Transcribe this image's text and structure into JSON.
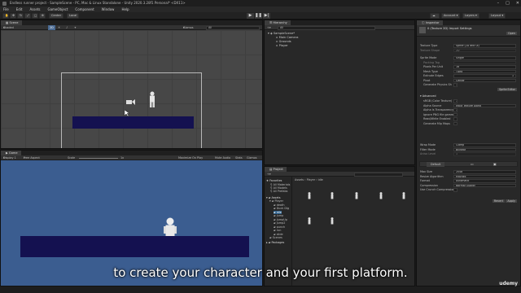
{
  "window": {
    "title": "Endless runner project - SampleScene - PC, Mac & Linux Standalone - Unity 2020.3.28f1 Personal* <DX11>"
  },
  "menu": [
    "File",
    "Edit",
    "Assets",
    "GameObject",
    "Component",
    "Window",
    "Help"
  ],
  "toolbar": {
    "center": "Center",
    "local": "Local",
    "account": "Account",
    "layers": "Layers",
    "layout": "Layout"
  },
  "scene": {
    "tab": "Scene",
    "shading": "Shaded",
    "gizmos": "Gizmos",
    "search_placeholder": "All"
  },
  "game": {
    "tab": "Game",
    "display": "Display 1",
    "aspect": "Free Aspect",
    "scale_label": "Scale",
    "scale_value": "1x",
    "maximize": "Maximize On Play",
    "mute": "Mute Audio",
    "stats": "Stats",
    "gizmos": "Gizmos"
  },
  "hierarchy": {
    "tab": "Hierarchy",
    "search_placeholder": "All",
    "root": "SampleScene*",
    "items": [
      "Main Camera",
      "Grounds",
      "Player"
    ]
  },
  "project": {
    "tab": "Project",
    "breadcrumb": [
      "Assets",
      "Player",
      "idle"
    ],
    "favorites": {
      "label": "Favorites",
      "items": [
        "All Materials",
        "All Models",
        "All Prefabs"
      ]
    },
    "assets": {
      "label": "Assets",
      "player": "Player",
      "children": [
        "death",
        "Duck Dig",
        "idle",
        "Jump",
        "JumpUp",
        "Jump2",
        "punch",
        "run",
        "slide"
      ],
      "scenes": "Scenes"
    },
    "packages": "Packages"
  },
  "inspector": {
    "tab": "Inspector",
    "header": "0 (Texture 2D) Import Settings",
    "open_button": "Open",
    "rows": [
      {
        "label": "Texture Type",
        "value": "Sprite (2D and UI)"
      },
      {
        "label": "Texture Shape",
        "value": "2D"
      },
      {
        "label": "Sprite Mode",
        "value": "Single"
      },
      {
        "label": "Packing Tag",
        "value": ""
      },
      {
        "label": "Pixels Per Unit",
        "value": "16"
      },
      {
        "label": "Mesh Type",
        "value": "Tight"
      },
      {
        "label": "Extrude Edges",
        "value": "1"
      },
      {
        "label": "Pivot",
        "value": "Center"
      },
      {
        "label": "Generate Physics Sh",
        "value": "✓"
      }
    ],
    "sprite_editor": "Sprite Editor",
    "advanced": "Advanced",
    "adv_rows": [
      {
        "label": "sRGB (Color Texture)",
        "value": "✓"
      },
      {
        "label": "Alpha Source",
        "value": "Input Texture Alpha"
      },
      {
        "label": "Alpha Is Transparency",
        "value": "✓"
      },
      {
        "label": "Ignore PNG file gamma",
        "value": ""
      },
      {
        "label": "Read/Write Enabled",
        "value": ""
      },
      {
        "label": "Generate Mip Maps",
        "value": ""
      }
    ],
    "wrap_rows": [
      {
        "label": "Wrap Mode",
        "value": "Clamp"
      },
      {
        "label": "Filter Mode",
        "value": "Bilinear"
      },
      {
        "label": "Aniso Level",
        "value": "1"
      }
    ],
    "platform_tab": "Default",
    "platform_rows": [
      {
        "label": "Max Size",
        "value": "2048"
      },
      {
        "label": "Resize Algorithm",
        "value": "Mitchell"
      },
      {
        "label": "Format",
        "value": "Automatic"
      },
      {
        "label": "Compression",
        "value": "Normal Quality"
      },
      {
        "label": "Use Crunch Compression",
        "value": ""
      }
    ],
    "revert": "Revert",
    "apply": "Apply"
  },
  "overlay": {
    "subtitle": "to create your character and your first platform.",
    "brand": "udemy"
  }
}
